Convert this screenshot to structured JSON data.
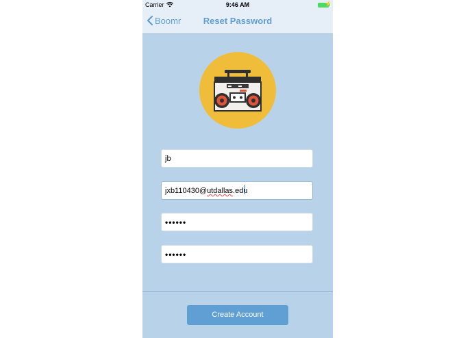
{
  "status_bar": {
    "carrier": "Carrier",
    "time": "9:46 AM",
    "wifi_icon": "wifi-icon",
    "battery_icon": "battery-icon"
  },
  "nav": {
    "back_label": "Boomr",
    "title": "Reset Password",
    "back_icon": "chevron-left-icon"
  },
  "form": {
    "username": "jb",
    "email_prefix": "jxb110430@",
    "email_underlined": "utdallas",
    "email_suffix": ".edu",
    "password": "••••••",
    "confirm_password": "••••••"
  },
  "submit_label": "Create Account",
  "colors": {
    "background": "#b8d3e9",
    "accent": "#5f9fd3",
    "logo_circle": "#efbd3a"
  }
}
